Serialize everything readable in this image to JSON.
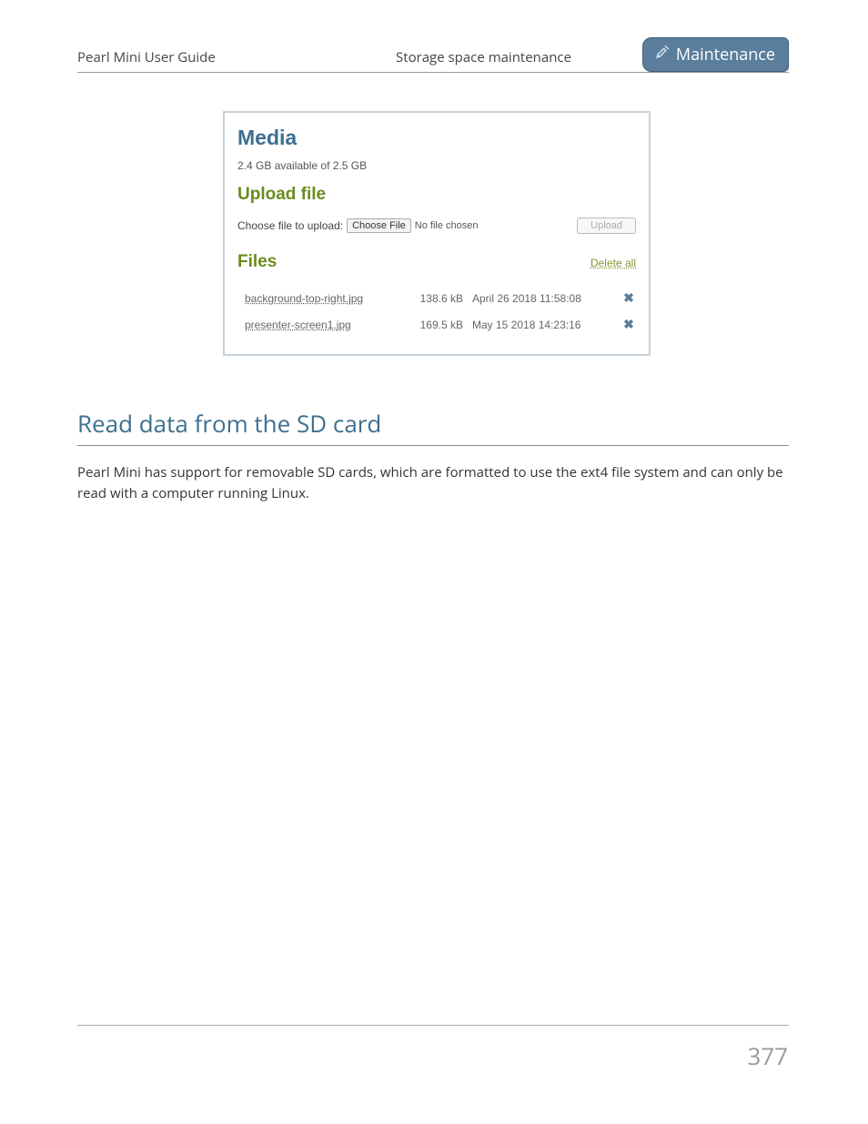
{
  "header": {
    "guide_title": "Pearl Mini User Guide",
    "section_title": "Storage space maintenance",
    "badge_label": "Maintenance"
  },
  "media_panel": {
    "heading": "Media",
    "storage_status": "2.4 GB available of 2.5 GB",
    "upload_heading": "Upload file",
    "choose_label": "Choose file to upload:",
    "choose_button": "Choose File",
    "no_file_text": "No file chosen",
    "upload_button": "Upload",
    "files_heading": "Files",
    "delete_all": "Delete all",
    "files": [
      {
        "name": "background-top-right.jpg",
        "size": "138.6 kB",
        "date": "April 26 2018 11:58:08"
      },
      {
        "name": "presenter-screen1.jpg",
        "size": "169.5 kB",
        "date": "May 15 2018 14:23:16"
      }
    ]
  },
  "section": {
    "heading": "Read data from the SD card",
    "body": "Pearl Mini has support for removable SD cards, which are formatted to use the ext4 file system and can only be read with a computer running Linux."
  },
  "page_number": "377"
}
